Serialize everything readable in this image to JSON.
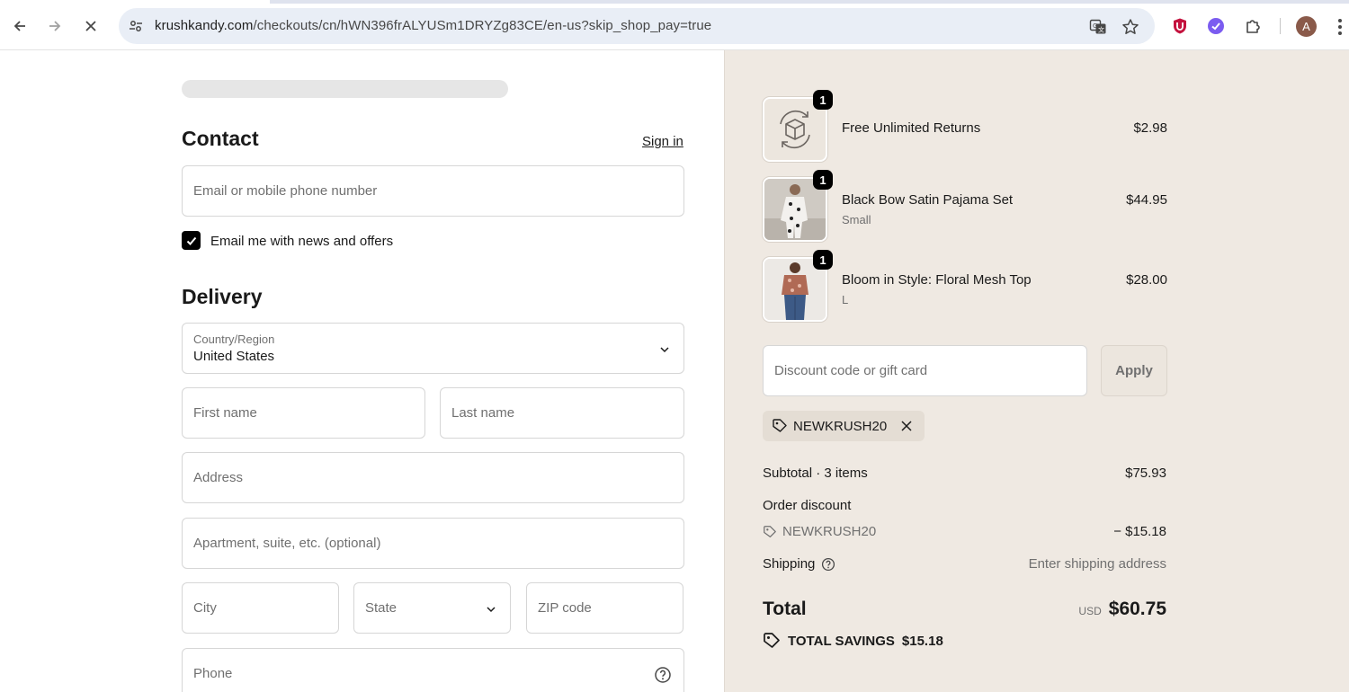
{
  "browser": {
    "url_host": "krushkandy.com",
    "url_path": "/checkouts/cn/hWN396frALYUSm1DRYZg83CE/en-us?skip_shop_pay=true",
    "avatar_initial": "A",
    "icons": [
      "back-icon",
      "forward-icon",
      "stop-icon",
      "site-info-icon",
      "translate-icon",
      "bookmark-star-icon",
      "ublock-icon",
      "extension-icon",
      "puzzle-icon",
      "menu-icon"
    ]
  },
  "contact": {
    "title": "Contact",
    "signin_label": "Sign in",
    "email_placeholder": "Email or mobile phone number",
    "newsletter_label": "Email me with news and offers",
    "newsletter_checked": true
  },
  "delivery": {
    "title": "Delivery",
    "country_label": "Country/Region",
    "country_value": "United States",
    "first_name_placeholder": "First name",
    "last_name_placeholder": "Last name",
    "address_placeholder": "Address",
    "apartment_placeholder": "Apartment, suite, etc. (optional)",
    "city_placeholder": "City",
    "state_placeholder": "State",
    "zip_placeholder": "ZIP code",
    "phone_placeholder": "Phone"
  },
  "summary": {
    "items": [
      {
        "name": "Free Unlimited Returns",
        "variant": "",
        "price": "$2.98",
        "qty": "1"
      },
      {
        "name": "Black Bow Satin Pajama Set",
        "variant": "Small",
        "price": "$44.95",
        "qty": "1"
      },
      {
        "name": "Bloom in Style: Floral Mesh Top",
        "variant": "L",
        "price": "$28.00",
        "qty": "1"
      }
    ],
    "discount_placeholder": "Discount code or gift card",
    "apply_label": "Apply",
    "applied_code": "NEWKRUSH20",
    "subtotal_label": "Subtotal · 3 items",
    "subtotal_value": "$75.93",
    "order_discount_label": "Order discount",
    "order_discount_code": "NEWKRUSH20",
    "order_discount_value": "− $15.18",
    "shipping_label": "Shipping",
    "shipping_value": "Enter shipping address",
    "total_label": "Total",
    "total_currency": "USD",
    "total_value": "$60.75",
    "savings_label": "TOTAL SAVINGS",
    "savings_value": "$15.18"
  }
}
